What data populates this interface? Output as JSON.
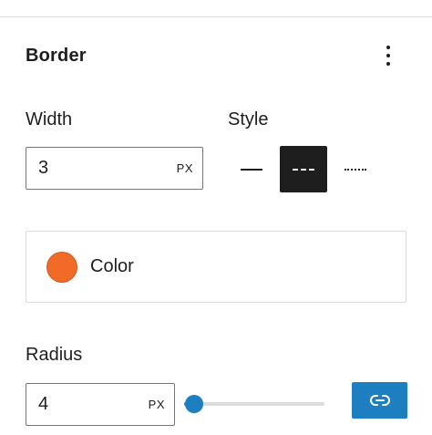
{
  "panel": {
    "title": "Border"
  },
  "width": {
    "label": "Width",
    "value": "3",
    "unit": "PX"
  },
  "style": {
    "label": "Style",
    "options": [
      "solid",
      "dashed",
      "dotted"
    ],
    "selected": "dashed"
  },
  "color": {
    "label": "Color",
    "swatch": "#f26a28"
  },
  "radius": {
    "label": "Radius",
    "value": "4",
    "unit": "PX",
    "slider_fraction": 0.07
  },
  "colors": {
    "accent": "#1e7fc0",
    "selected_style_bg": "#1e1e1e"
  },
  "icons": {
    "options": "kebab-vertical-icon",
    "link": "link-icon"
  }
}
